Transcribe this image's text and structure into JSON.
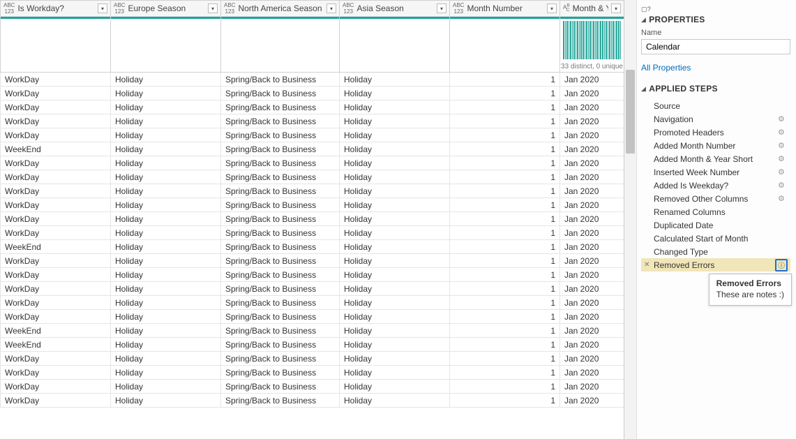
{
  "columns": [
    {
      "name": "Is Workday?",
      "type": "ABC123",
      "stats": ""
    },
    {
      "name": "Europe Season",
      "type": "ABC123",
      "stats": ""
    },
    {
      "name": "North America Season",
      "type": "ABC123",
      "stats": ""
    },
    {
      "name": "Asia Season",
      "type": "ABC123",
      "stats": ""
    },
    {
      "name": "Month Number",
      "type": "ABC123",
      "stats": ""
    },
    {
      "name": "Month & Year",
      "type": "ABC",
      "stats": "33 distinct, 0 unique"
    }
  ],
  "rows": [
    [
      "WorkDay",
      "Holiday",
      "Spring/Back to Business",
      "Holiday",
      "1",
      "Jan 2020"
    ],
    [
      "WorkDay",
      "Holiday",
      "Spring/Back to Business",
      "Holiday",
      "1",
      "Jan 2020"
    ],
    [
      "WorkDay",
      "Holiday",
      "Spring/Back to Business",
      "Holiday",
      "1",
      "Jan 2020"
    ],
    [
      "WorkDay",
      "Holiday",
      "Spring/Back to Business",
      "Holiday",
      "1",
      "Jan 2020"
    ],
    [
      "WorkDay",
      "Holiday",
      "Spring/Back to Business",
      "Holiday",
      "1",
      "Jan 2020"
    ],
    [
      "WeekEnd",
      "Holiday",
      "Spring/Back to Business",
      "Holiday",
      "1",
      "Jan 2020"
    ],
    [
      "WorkDay",
      "Holiday",
      "Spring/Back to Business",
      "Holiday",
      "1",
      "Jan 2020"
    ],
    [
      "WorkDay",
      "Holiday",
      "Spring/Back to Business",
      "Holiday",
      "1",
      "Jan 2020"
    ],
    [
      "WorkDay",
      "Holiday",
      "Spring/Back to Business",
      "Holiday",
      "1",
      "Jan 2020"
    ],
    [
      "WorkDay",
      "Holiday",
      "Spring/Back to Business",
      "Holiday",
      "1",
      "Jan 2020"
    ],
    [
      "WorkDay",
      "Holiday",
      "Spring/Back to Business",
      "Holiday",
      "1",
      "Jan 2020"
    ],
    [
      "WorkDay",
      "Holiday",
      "Spring/Back to Business",
      "Holiday",
      "1",
      "Jan 2020"
    ],
    [
      "WeekEnd",
      "Holiday",
      "Spring/Back to Business",
      "Holiday",
      "1",
      "Jan 2020"
    ],
    [
      "WorkDay",
      "Holiday",
      "Spring/Back to Business",
      "Holiday",
      "1",
      "Jan 2020"
    ],
    [
      "WorkDay",
      "Holiday",
      "Spring/Back to Business",
      "Holiday",
      "1",
      "Jan 2020"
    ],
    [
      "WorkDay",
      "Holiday",
      "Spring/Back to Business",
      "Holiday",
      "1",
      "Jan 2020"
    ],
    [
      "WorkDay",
      "Holiday",
      "Spring/Back to Business",
      "Holiday",
      "1",
      "Jan 2020"
    ],
    [
      "WorkDay",
      "Holiday",
      "Spring/Back to Business",
      "Holiday",
      "1",
      "Jan 2020"
    ],
    [
      "WeekEnd",
      "Holiday",
      "Spring/Back to Business",
      "Holiday",
      "1",
      "Jan 2020"
    ],
    [
      "WeekEnd",
      "Holiday",
      "Spring/Back to Business",
      "Holiday",
      "1",
      "Jan 2020"
    ],
    [
      "WorkDay",
      "Holiday",
      "Spring/Back to Business",
      "Holiday",
      "1",
      "Jan 2020"
    ],
    [
      "WorkDay",
      "Holiday",
      "Spring/Back to Business",
      "Holiday",
      "1",
      "Jan 2020"
    ],
    [
      "WorkDay",
      "Holiday",
      "Spring/Back to Business",
      "Holiday",
      "1",
      "Jan 2020"
    ],
    [
      "WorkDay",
      "Holiday",
      "Spring/Back to Business",
      "Holiday",
      "1",
      "Jan 2020"
    ]
  ],
  "properties": {
    "section_title": "PROPERTIES",
    "name_label": "Name",
    "name_value": "Calendar",
    "all_properties_link": "All Properties"
  },
  "applied_steps": {
    "section_title": "APPLIED STEPS",
    "items": [
      {
        "label": "Source",
        "gear": false
      },
      {
        "label": "Navigation",
        "gear": true
      },
      {
        "label": "Promoted Headers",
        "gear": true
      },
      {
        "label": "Added Month Number",
        "gear": true
      },
      {
        "label": "Added Month & Year Short",
        "gear": true
      },
      {
        "label": "Inserted Week Number",
        "gear": true
      },
      {
        "label": "Added Is Weekday?",
        "gear": true
      },
      {
        "label": "Removed Other Columns",
        "gear": true
      },
      {
        "label": "Renamed Columns",
        "gear": false
      },
      {
        "label": "Duplicated Date",
        "gear": false
      },
      {
        "label": "Calculated Start of Month",
        "gear": false
      },
      {
        "label": "Changed Type",
        "gear": false
      },
      {
        "label": "Removed Errors",
        "gear": false,
        "selected": true,
        "delete": true,
        "info": true
      }
    ]
  },
  "tooltip": {
    "title": "Removed Errors",
    "body": "These are notes :)"
  },
  "type_labels": {
    "ABC123": {
      "top": "ABC",
      "bottom": "123"
    },
    "ABC": {
      "top": "A",
      "bottom": "",
      "mixed": "B C",
      "small": "A B C"
    }
  }
}
